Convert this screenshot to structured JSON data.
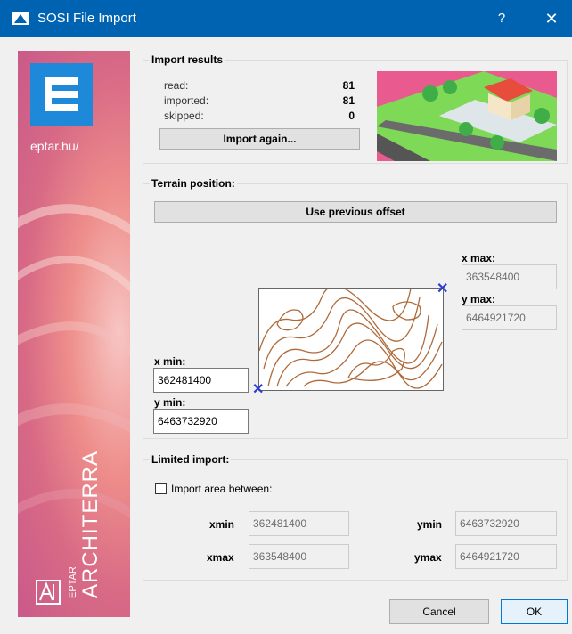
{
  "window": {
    "title": "SOSI File Import",
    "help": "?",
    "close": "✕"
  },
  "banner": {
    "site": "eptar.hu/",
    "brand_small": "EPTAR",
    "brand_big": "ARCHITERRA",
    "colors": {
      "logo": "#1e88d9"
    }
  },
  "import_results": {
    "title": "Import results",
    "rows": [
      {
        "label": "read:",
        "value": "81"
      },
      {
        "label": "imported:",
        "value": "81"
      },
      {
        "label": "skipped:",
        "value": "0"
      }
    ],
    "import_again_label": "Import again..."
  },
  "terrain": {
    "title": "Terrain position:",
    "use_previous_label": "Use previous offset",
    "xmax_label": "x max:",
    "xmax_value": "363548400",
    "ymax_label": "y max:",
    "ymax_value": "6464921720",
    "xmin_label": "x min:",
    "xmin_value": "362481400",
    "ymin_label": "y min:",
    "ymin_value": "6463732920"
  },
  "limited": {
    "title": "Limited import:",
    "checkbox_label": "Import area between:",
    "checked": false,
    "xmin_label": "xmin",
    "xmin_value": "362481400",
    "ymin_label": "ymin",
    "ymin_value": "6463732920",
    "xmax_label": "xmax",
    "xmax_value": "363548400",
    "ymax_label": "ymax",
    "ymax_value": "6464921720"
  },
  "footer": {
    "cancel_label": "Cancel",
    "ok_label": "OK"
  },
  "colors": {
    "titlebar": "#0063b1",
    "marker": "#2b3ccf",
    "contour": "#b06a3a"
  }
}
